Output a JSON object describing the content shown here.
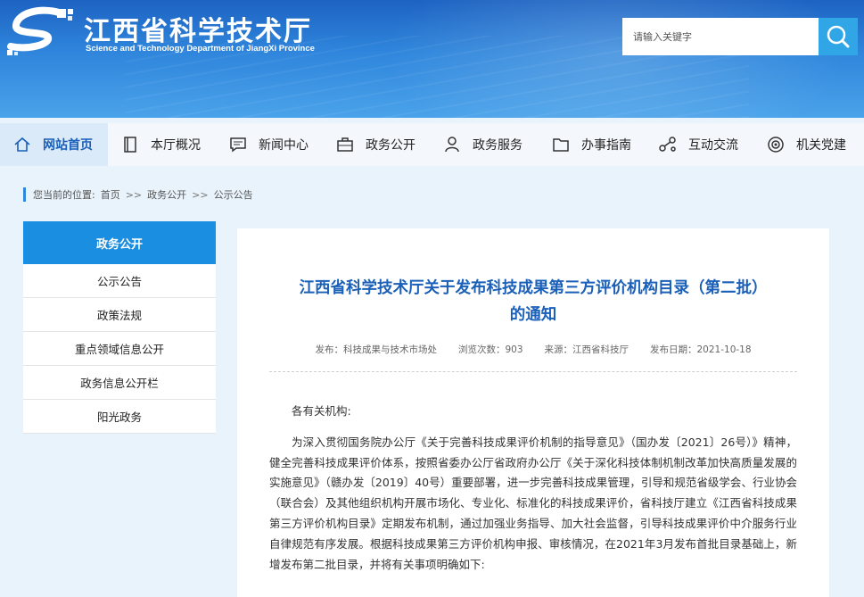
{
  "header": {
    "title": "江西省科学技术厅",
    "subtitle": "Science and Technology Department of JiangXi Province",
    "search_placeholder": "请输入关键字",
    "search_icon": "search-icon"
  },
  "nav": {
    "items": [
      {
        "label": "网站首页",
        "icon": "home-icon"
      },
      {
        "label": "本厅概况",
        "icon": "book-icon"
      },
      {
        "label": "新闻中心",
        "icon": "chat-icon"
      },
      {
        "label": "政务公开",
        "icon": "briefcase-icon"
      },
      {
        "label": "政务服务",
        "icon": "user-icon"
      },
      {
        "label": "办事指南",
        "icon": "folder-icon"
      },
      {
        "label": "互动交流",
        "icon": "share-icon"
      },
      {
        "label": "机关党建",
        "icon": "emblem-icon"
      }
    ]
  },
  "breadcrumb": {
    "prefix": "您当前的位置:",
    "items": [
      "首页",
      "政务公开",
      "公示公告"
    ],
    "sep": ">>"
  },
  "sidebar": {
    "heading": "政务公开",
    "items": [
      "公示公告",
      "政策法规",
      "重点领域信息公开",
      "政务信息公开栏",
      "阳光政务"
    ]
  },
  "article": {
    "title_line1": "江西省科学技术厅关于发布科技成果第三方评价机构目录（第二批）",
    "title_line2": "的通知",
    "meta": {
      "publisher": "发布：科技成果与技术市场处",
      "views": "浏览次数：903",
      "source": "来源：江西省科技厅",
      "date": "发布日期：2021-10-18"
    },
    "greeting": "各有关机构:",
    "paragraph1": "为深入贯彻国务院办公厅《关于完善科技成果评价机制的指导意见》（国办发〔2021〕26号）》精神，健全完善科技成果评价体系，按照省委办公厅省政府办公厅《关于深化科技体制机制改革加快高质量发展的实施意见》（赣办发〔2019〕40号）重要部署，进一步完善科技成果管理，引导和规范省级学会、行业协会（联合会）及其他组织机构开展市场化、专业化、标准化的科技成果评价，省科技厅建立《江西省科技成果第三方评价机构目录》定期发布机制，通过加强业务指导、加大社会监督，引导科技成果评价中介服务行业自律规范有序发展。根据科技成果第三方评价机构申报、审核情况，在2021年3月发布首批目录基础上，新增发布第二批目录，并将有关事项明确如下:"
  }
}
